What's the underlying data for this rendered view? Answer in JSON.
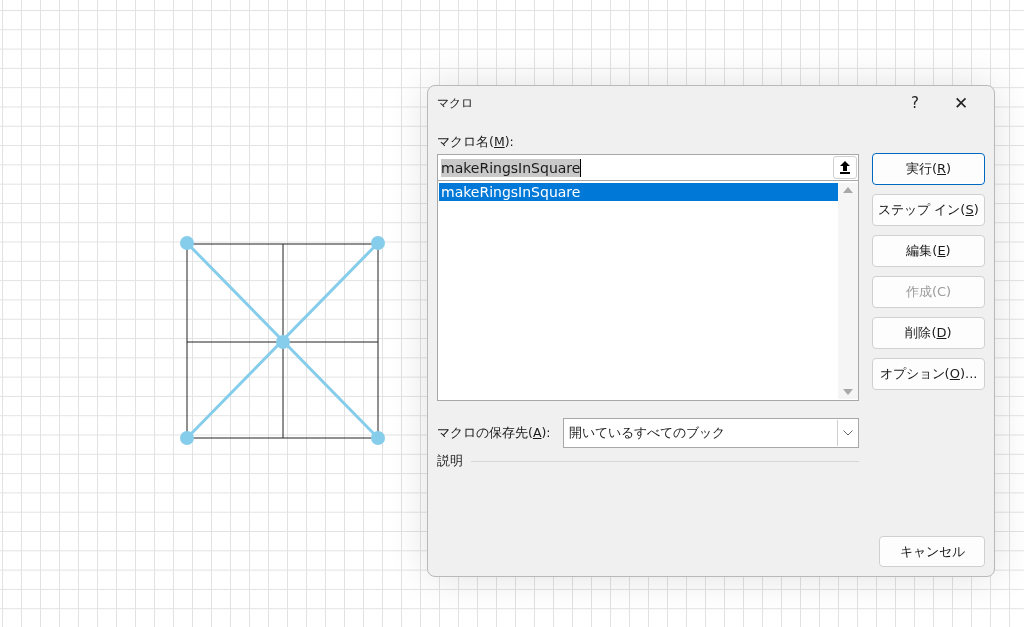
{
  "dialog": {
    "title": "マクロ",
    "help": "?",
    "close": "✕",
    "name_label": {
      "before": "マクロ名(",
      "key": "M",
      "after": "):"
    },
    "name_field": {
      "value": "makeRingsInSquare",
      "text_selected": true
    },
    "macros": [
      {
        "label": "makeRingsInSquare",
        "selected": true
      }
    ],
    "buttons": [
      {
        "before": "実行(",
        "key": "R",
        "after": ")",
        "default": true,
        "disabled": false
      },
      {
        "before": "ステップ イン(",
        "key": "S",
        "after": ")",
        "default": false,
        "disabled": false
      },
      {
        "before": "編集(",
        "key": "E",
        "after": ")",
        "default": false,
        "disabled": false
      },
      {
        "before": "作成(C)",
        "default": false,
        "disabled": true
      },
      {
        "before": "削除(",
        "key": "D",
        "after": ")",
        "default": false,
        "disabled": false
      },
      {
        "before": "オプション(",
        "key": "O",
        "after": ")...",
        "default": false,
        "disabled": false
      }
    ],
    "location_label": {
      "before": "マクロの保存先(",
      "key": "A",
      "after": "):"
    },
    "location_value": "開いているすべてのブック",
    "description_label": "説明",
    "cancel": {
      "before": "キャンセル",
      "default": false,
      "disabled": false
    }
  }
}
